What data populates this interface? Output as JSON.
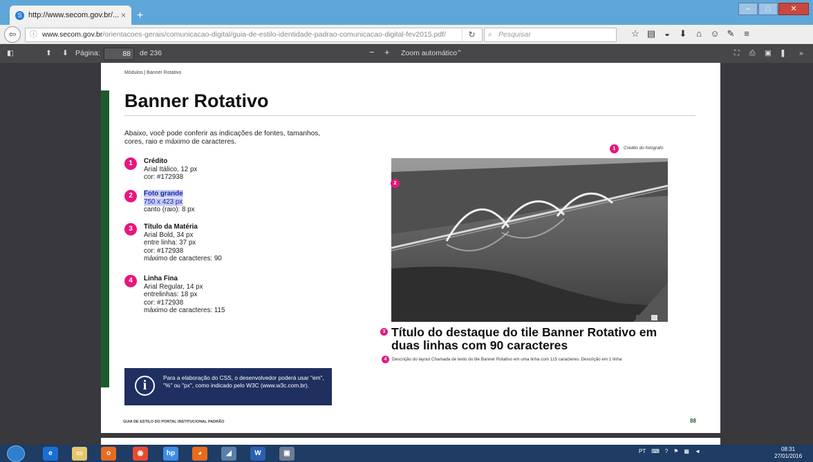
{
  "browser": {
    "tab_title": "http://www.secom.gov.br/...",
    "tab_close": "×",
    "new_tab": "+",
    "url_host": "www.secom.gov.br",
    "url_path": "/orientacoes-gerais/comunicacao-digital/guia-de-estilo-identidade-padrao-comunicacao-digital-fev2015.pdf/",
    "search_placeholder": "Pesquisar",
    "nav_icons": [
      "star-icon",
      "bookmarks-icon",
      "pocket-icon",
      "download-icon",
      "home-icon",
      "chat-icon",
      "extension-icon",
      "menu-icon"
    ]
  },
  "pdf_toolbar": {
    "page_label": "Página:",
    "page_value": "88",
    "page_total": "de 236",
    "zoom_minus": "−",
    "zoom_plus": "+",
    "zoom_label": "Zoom automático"
  },
  "document": {
    "breadcrumb": "Módulos | Banner Rotativo",
    "title": "Banner Rotativo",
    "intro": "Abaixo, você pode conferir as indicações de fontes, tamanhos, cores, raio e máximo de caracteres.",
    "specs": [
      {
        "num": "1",
        "head": "Crédito",
        "lines": [
          "Arial Itálico, 12 px",
          "cor: #172938"
        ]
      },
      {
        "num": "2",
        "head": "Foto grande",
        "lines": [
          "750 x 423 px",
          "canto (raio): 8 px"
        ]
      },
      {
        "num": "3",
        "head": "Título da Matéria",
        "lines": [
          "Arial Bold, 34 px",
          "entre linha: 37 px",
          "cor: #172938",
          "máximo de caracteres: 90"
        ]
      },
      {
        "num": "4",
        "head": "Linha Fina",
        "lines": [
          "Arial Regular, 14 px",
          "entrelinhas: 18 px",
          "cor: #172938",
          "máximo de caracteres: 115"
        ]
      }
    ],
    "info_box": "Para a elaboração do CSS, o desenvolvedor poderá usar \"em\", \"%\" ou \"px\", como indicado pelo W3C (www.w3c.com.br).",
    "info_icon": "i",
    "footer": "GUIA DE ESTILO DO PORTAL INSTITUCIONAL PADRÃO",
    "page_number": "88",
    "example": {
      "credit": "Crédito do fotógrafo",
      "headline": "Título do destaque do tile Banner Rotativo em duas linhas com 90 caracteres",
      "fine_line": "Descrição do layout Chamada de texto do tile Banner Rotativo em uma linha com 115 caracteres. Descrição em 1 linha"
    }
  },
  "taskbar": {
    "tray_lang": "PT",
    "time": "08:31",
    "date": "27/01/2016"
  },
  "colors": {
    "accent_pink": "#e6177d",
    "green_bar": "#1c5b2e",
    "info_blue": "#1f2f60",
    "highlight": "#c6cbf4"
  }
}
